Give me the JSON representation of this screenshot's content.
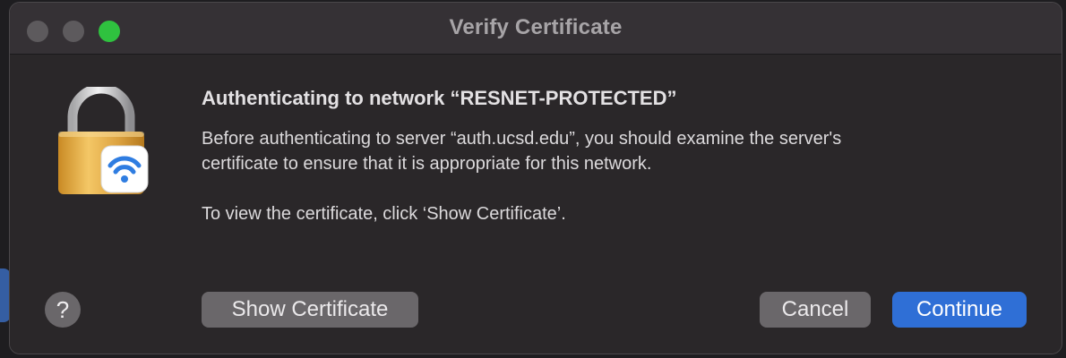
{
  "window": {
    "title": "Verify Certificate"
  },
  "dialog": {
    "heading": "Authenticating to network “RESNET-PROTECTED”",
    "message_lines": [
      "Before authenticating to server “auth.ucsd.edu”, you should examine the server's",
      "certificate to ensure that it is appropriate for this network."
    ],
    "instruction": "To view the certificate, click ‘Show Certificate’."
  },
  "buttons": {
    "help": "?",
    "show_certificate": "Show Certificate",
    "cancel": "Cancel",
    "continue": "Continue"
  },
  "icons": {
    "main": "lock-wifi-icon"
  },
  "colors": {
    "accent": "#2f6fd6",
    "zoom": "#2fc23f",
    "lock_body": "#d9a441",
    "wifi": "#2f7de1"
  }
}
